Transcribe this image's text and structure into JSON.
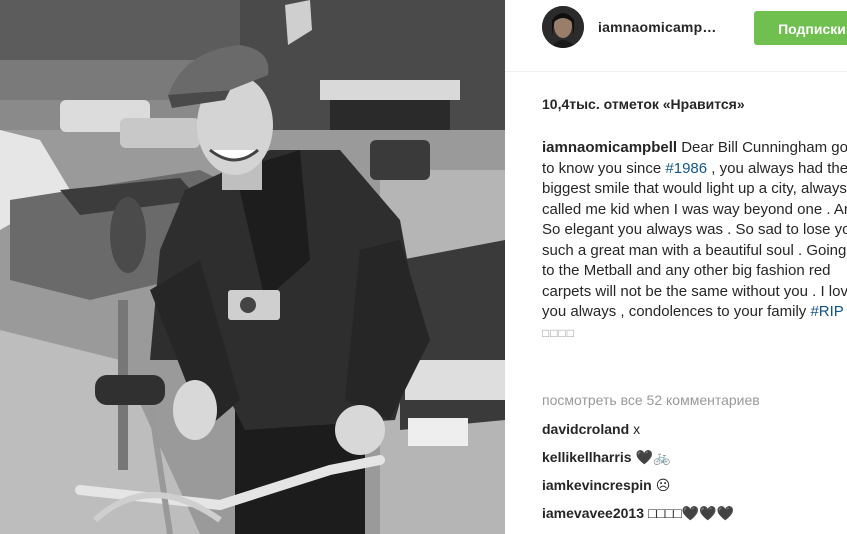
{
  "photo": {
    "description_icon": "photo-of-man-with-bicycle"
  },
  "header": {
    "avatar_icon": "profile-avatar-icon",
    "username": "iamnaomicamp…",
    "follow_label": "Подписки",
    "follow_color": "#70c050"
  },
  "likes": {
    "text": "10,4тыс. отметок «Нравится»"
  },
  "caption": {
    "username": "iamnaomicampbell",
    "text_1": " Dear Bill Cunningham got to know you since ",
    "tag_1": "#1986",
    "text_2": " , you always had the biggest smile that would light up a city, always called me kid when I was way beyond one . And So elegant you always was . So sad to lose you such a great man with a beautiful soul . Going to the Metball and any other big fashion red carpets will not be the same without you . I love you always , condolences to your family ",
    "tag_2": "#RIP",
    "trailing_symbols": "□□□□"
  },
  "comments_link": "посмотреть все 52 комментариев",
  "comments": [
    {
      "user": "davidcroland",
      "text": "x"
    },
    {
      "user": "kellikellharris",
      "text": "🖤🚲"
    },
    {
      "user": "iamkevincrespin",
      "text": "☹"
    },
    {
      "user": "iamevavee2013",
      "text": "□□□□🖤🖤🖤"
    }
  ],
  "colors": {
    "link": "#125688",
    "text": "#262626",
    "muted": "#999999"
  }
}
